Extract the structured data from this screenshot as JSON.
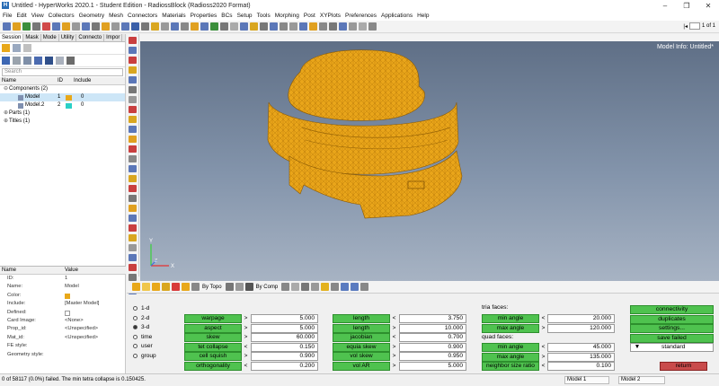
{
  "window": {
    "title": "Untitled - HyperWorks 2020.1 - Student Edition - RadiossBlock (Radioss2020 Format)",
    "controls": [
      "–",
      "❐",
      "✕"
    ]
  },
  "menu": [
    "File",
    "Edit",
    "View",
    "Collectors",
    "Geometry",
    "Mesh",
    "Connectors",
    "Materials",
    "Properties",
    "BCs",
    "Setup",
    "Tools",
    "Morphing",
    "Post",
    "XYPlots",
    "Preferences",
    "Applications",
    "Help"
  ],
  "pager": {
    "text": "1 of 1"
  },
  "browser": {
    "tabs": [
      "Session",
      "Mask",
      "Mode",
      "Utility",
      "Connecto",
      "Impor"
    ],
    "search_placeholder": "Search",
    "tree_head": {
      "name": "Name",
      "id": "ID",
      "color": "",
      "include": "Include"
    },
    "tree": [
      {
        "label": "Components (2)",
        "level": 0
      },
      {
        "label": "Model",
        "id": "1",
        "color": "#e8a81a",
        "include": "0",
        "level": 2
      },
      {
        "label": "Model.2",
        "id": "2",
        "color": "#2ad0c7",
        "include": "0",
        "level": 2
      },
      {
        "label": "Parts (1)",
        "level": 0
      },
      {
        "label": "Titles (1)",
        "level": 0
      }
    ],
    "props_head": {
      "name": "Name",
      "value": "Value"
    },
    "props": [
      {
        "name": "ID:",
        "value": "1"
      },
      {
        "name": "Name:",
        "value": "Model"
      },
      {
        "name": "Color:",
        "value": ""
      },
      {
        "name": "Include:",
        "value": "[Master Model]"
      },
      {
        "name": "Defined:",
        "value": ""
      },
      {
        "name": "Card Image:",
        "value": "<None>"
      },
      {
        "name": "Prop_id:",
        "value": "<Unspecified>"
      },
      {
        "name": "Mat_id:",
        "value": "<Unspecified>"
      },
      {
        "name": "FE style:",
        "value": ""
      },
      {
        "name": "Geometry style:",
        "value": ""
      }
    ]
  },
  "viewport": {
    "model_info": "Model Info: Untitled*",
    "axis_y": "Y",
    "axis_x": "X",
    "axis_z": "Z"
  },
  "toolbar2": {
    "by_topo": "By Topo",
    "by_comp": "By Comp"
  },
  "panel": {
    "radios": [
      {
        "label": "1-d",
        "on": false
      },
      {
        "label": "2-d",
        "on": false
      },
      {
        "label": "3-d",
        "on": true
      },
      {
        "label": "time",
        "on": false
      },
      {
        "label": "user",
        "on": false
      },
      {
        "label": "group",
        "on": false
      }
    ],
    "col1": [
      {
        "label": "warpage",
        "op": ">",
        "value": "5.000"
      },
      {
        "label": "aspect",
        "op": ">",
        "value": "5.000"
      },
      {
        "label": "skew",
        "op": ">",
        "value": "60.000"
      },
      {
        "label": "tet collapse",
        "op": "<",
        "value": "0.150"
      },
      {
        "label": "cell squish",
        "op": ">",
        "value": "0.900"
      },
      {
        "label": "orthogonality",
        "op": "<",
        "value": "0.200"
      }
    ],
    "col2": [
      {
        "label": "length",
        "op": "<",
        "value": "3.750"
      },
      {
        "label": "length",
        "op": ">",
        "value": "10.000"
      },
      {
        "label": "jacobian",
        "op": "<",
        "value": "0.700"
      },
      {
        "label": "equia skew",
        "op": ">",
        "value": "0.900"
      },
      {
        "label": "vol skew",
        "op": ">",
        "value": "0.950"
      },
      {
        "label": "vol AR",
        "op": ">",
        "value": "5.000"
      }
    ],
    "tria_label": "tria faces:",
    "tria": [
      {
        "label": "min angle",
        "op": "<",
        "value": "20.000"
      },
      {
        "label": "max angle",
        "op": ">",
        "value": "120.000"
      }
    ],
    "quad_label": "quad faces:",
    "quad": [
      {
        "label": "min angle",
        "op": "<",
        "value": "45.000"
      },
      {
        "label": "max angle",
        "op": ">",
        "value": "135.000"
      },
      {
        "label": "neighbor size ratio",
        "op": "<",
        "value": "0.100"
      }
    ],
    "right_buttons": [
      "connectivity",
      "duplicates",
      "settings...",
      "save failed"
    ],
    "standard": "standard",
    "return": "return"
  },
  "status": {
    "message": "0 of 58117 (0.0%) failed.  The min tetra collapse is 0.150425.",
    "cell_model": "Model 1",
    "cell_model2": "Model 2"
  }
}
